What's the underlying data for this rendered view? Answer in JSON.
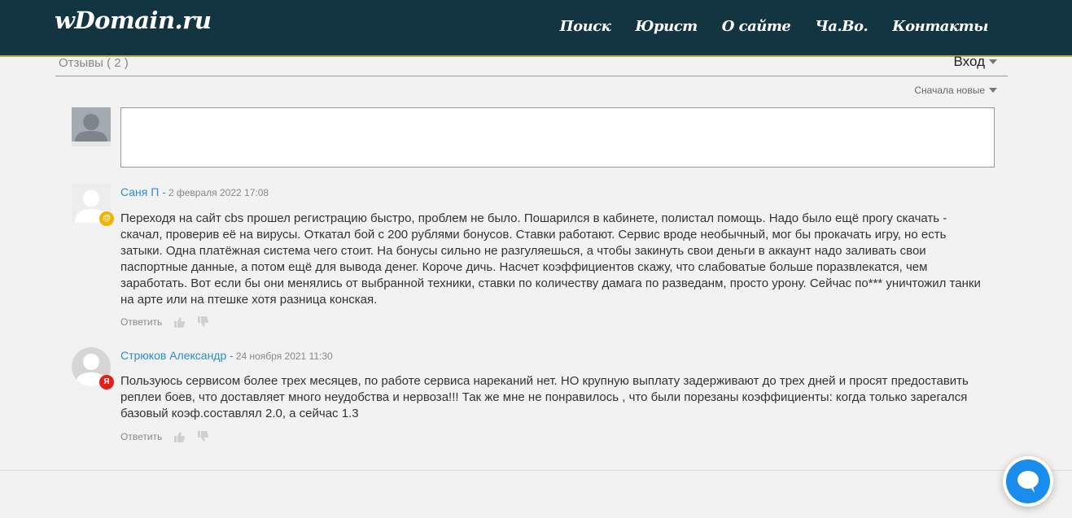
{
  "header": {
    "logo": "wDomain.ru",
    "nav": [
      "Поиск",
      "Юрист",
      "О сайте",
      "Ча.Во.",
      "Контакты"
    ]
  },
  "reviews": {
    "title": "Отзывы ( 2 )",
    "login": "Вход",
    "sort": "Сначала новые"
  },
  "comments": [
    {
      "author": "Саня П -",
      "date": "2 февраля 2022 17:08",
      "badge": "@",
      "badge_color": "#f0b400",
      "text": "Переходя на сайт cbs прошел регистрацию быстро, проблем не было. Пошарился в кабинете, полистал помощь. Надо было ещё прогу скачать - скачал, проверив её на вирусы. Откатал бой с 200 рублями бонусов. Ставки работают. Сервис вроде необычный, мог бы прокачать игру, но есть затыки. Одна платёжная система чего стоит. На бонусы сильно не разгуляешься, а чтобы закинуть свои деньги в аккаунт надо заливать свои паспортные данные, а потом ещё для вывода денег. Короче дичь. Насчет коэффициентов скажу, что слабоватые больше поразвлекатся, чем заработать. Вот если бы они менялись от выбранной техники, ставки по количеству дамага по разведанм, просто урону. Сейчас по*** уничтожил танки на арте или на птешке хотя разница конская.",
      "reply": "Ответить"
    },
    {
      "author": "Стрюков Александр -",
      "date": "24 ноября 2021 11:30",
      "badge": "Я",
      "badge_color": "#e0211b",
      "text": "Пользуюсь сервисом более трех месяцев, по работе сервиса нареканий нет. НО крупную выплату задерживают до трех дней и просят предоставить реплеи боев, что доставляет много неудобства и нервоза!!! Так же мне не понравилось , что были порезаны коэффициенты: когда только зарегался базовый коэф.составлял 2.0, а сейчас 1.3",
      "reply": "Ответить"
    }
  ],
  "colors": {
    "topbar": "#123541",
    "link": "#2a8fc9",
    "chat": "#1a8ceb"
  }
}
